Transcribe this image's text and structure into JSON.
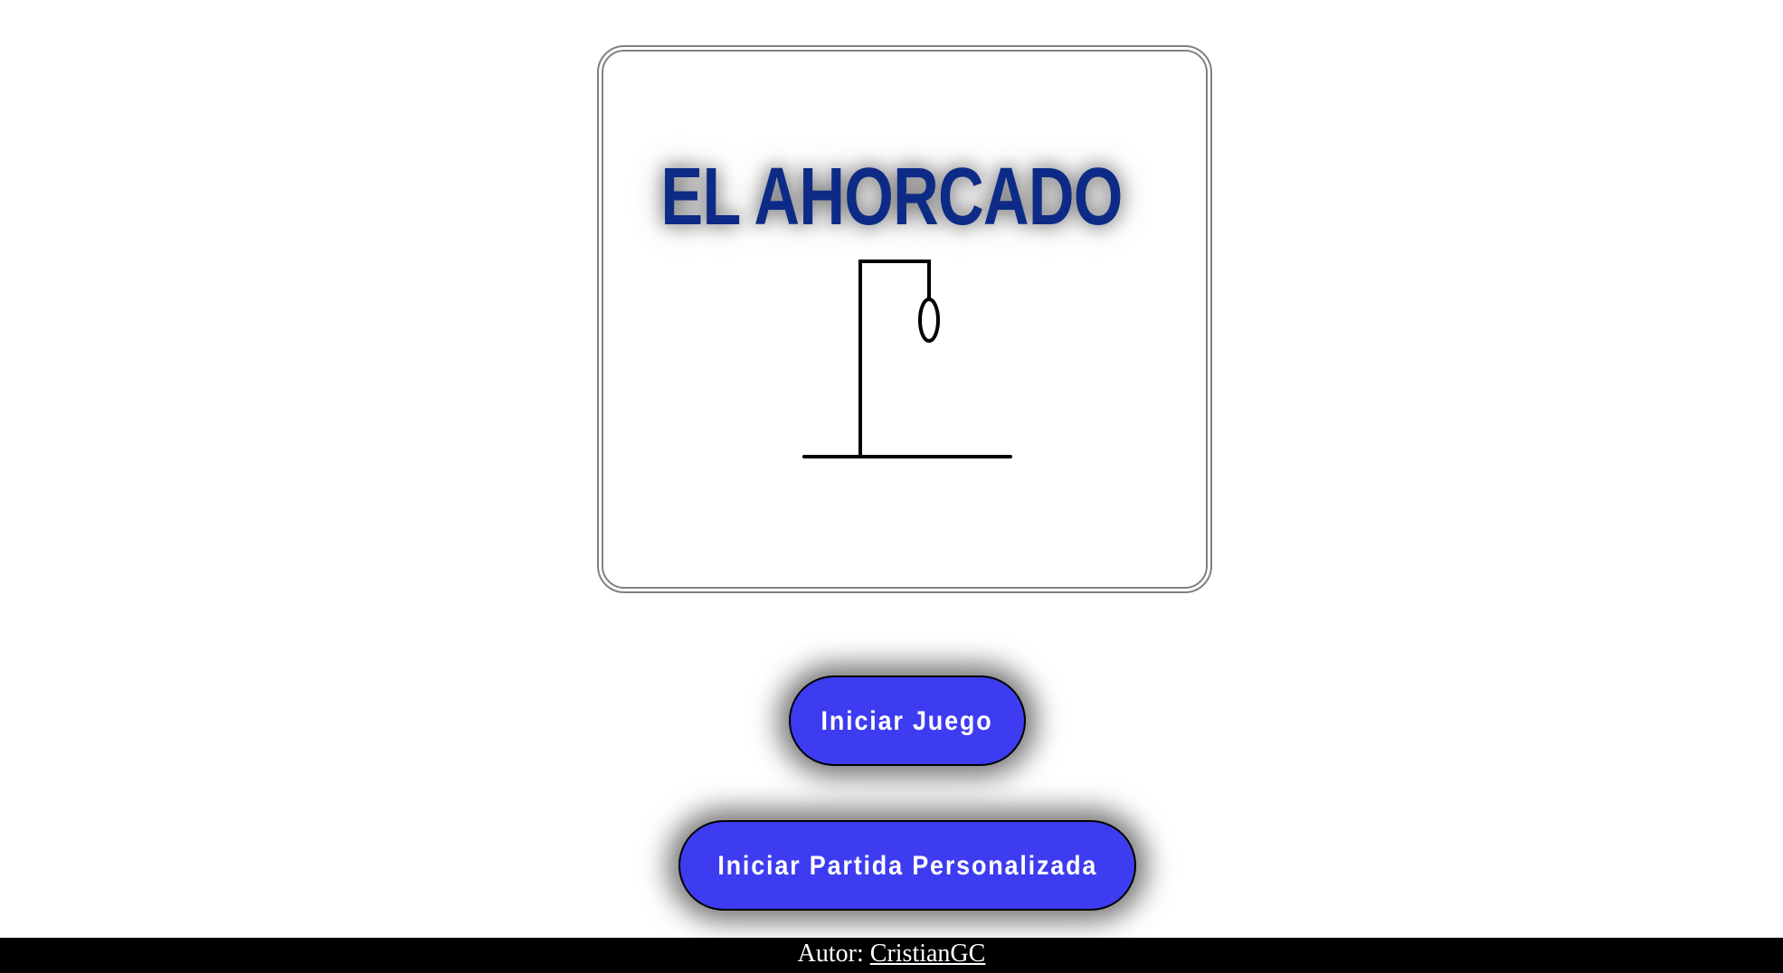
{
  "game": {
    "title": "EL AHORCADO",
    "title_color": "#0d2b86",
    "illustration": "gallows-icon"
  },
  "buttons": {
    "start_label": "Iniciar Juego",
    "custom_label": "Iniciar Partida Personalizada",
    "color": "#3e3cf0"
  },
  "footer": {
    "author_label": "Autor:",
    "author_name": "CristianGC"
  }
}
